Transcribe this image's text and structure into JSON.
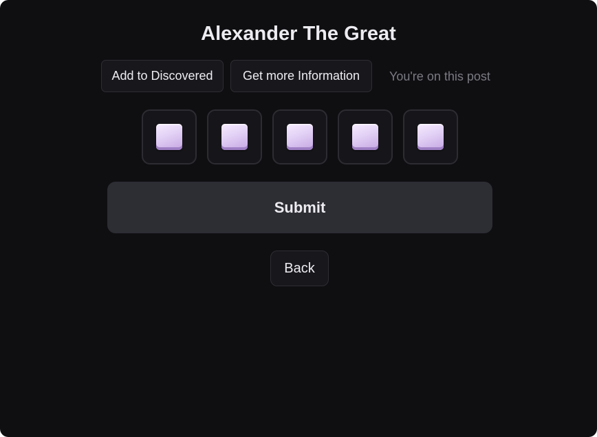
{
  "page": {
    "title": "Alexander The Great"
  },
  "actions": {
    "add_label": "Add to Discovered",
    "info_label": "Get more Information",
    "status_text": "You're on this post"
  },
  "squares": [
    {
      "icon": "purple-square-icon"
    },
    {
      "icon": "purple-square-icon"
    },
    {
      "icon": "purple-square-icon"
    },
    {
      "icon": "purple-square-icon"
    },
    {
      "icon": "purple-square-icon"
    }
  ],
  "form": {
    "submit_label": "Submit",
    "back_label": "Back"
  },
  "colors": {
    "background": "#0f0f12",
    "button_bg": "#18181c",
    "submit_bg": "#2d2d34",
    "square_color": "#d9c4f0",
    "muted_text": "#7a7a82"
  }
}
